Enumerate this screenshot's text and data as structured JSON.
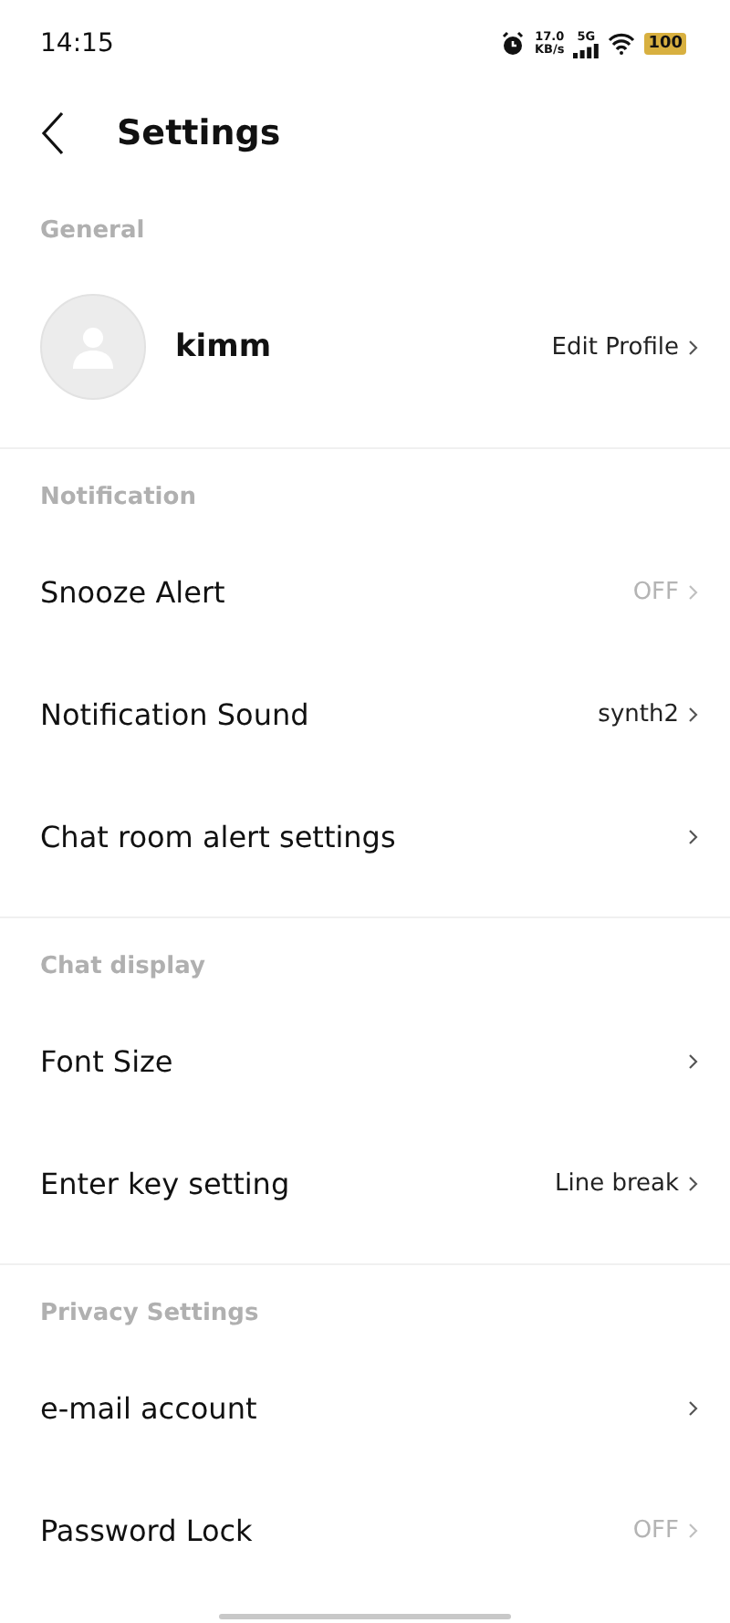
{
  "status_bar": {
    "time": "14:15",
    "speed": "17.0",
    "speed_unit": "KB/s",
    "network": "5G",
    "battery": "100"
  },
  "header": {
    "title": "Settings"
  },
  "sections": [
    {
      "title": "General",
      "items": [
        {
          "kind": "profile",
          "name": "kimm",
          "value": "Edit Profile",
          "dimmed": false
        }
      ]
    },
    {
      "title": "Notification",
      "items": [
        {
          "kind": "row",
          "label": "Snooze Alert",
          "value": "OFF",
          "dimmed": true
        },
        {
          "kind": "row",
          "label": "Notification Sound",
          "value": "synth2",
          "dimmed": false
        },
        {
          "kind": "row",
          "label": "Chat room alert settings"
        }
      ]
    },
    {
      "title": "Chat display",
      "items": [
        {
          "kind": "row",
          "label": "Font Size"
        },
        {
          "kind": "row",
          "label": "Enter key setting",
          "value": "Line break",
          "dimmed": false
        }
      ]
    },
    {
      "title": "Privacy Settings",
      "items": [
        {
          "kind": "row",
          "label": "e-mail account"
        },
        {
          "kind": "row",
          "label": "Password Lock",
          "value": "OFF",
          "dimmed": true
        }
      ]
    }
  ]
}
